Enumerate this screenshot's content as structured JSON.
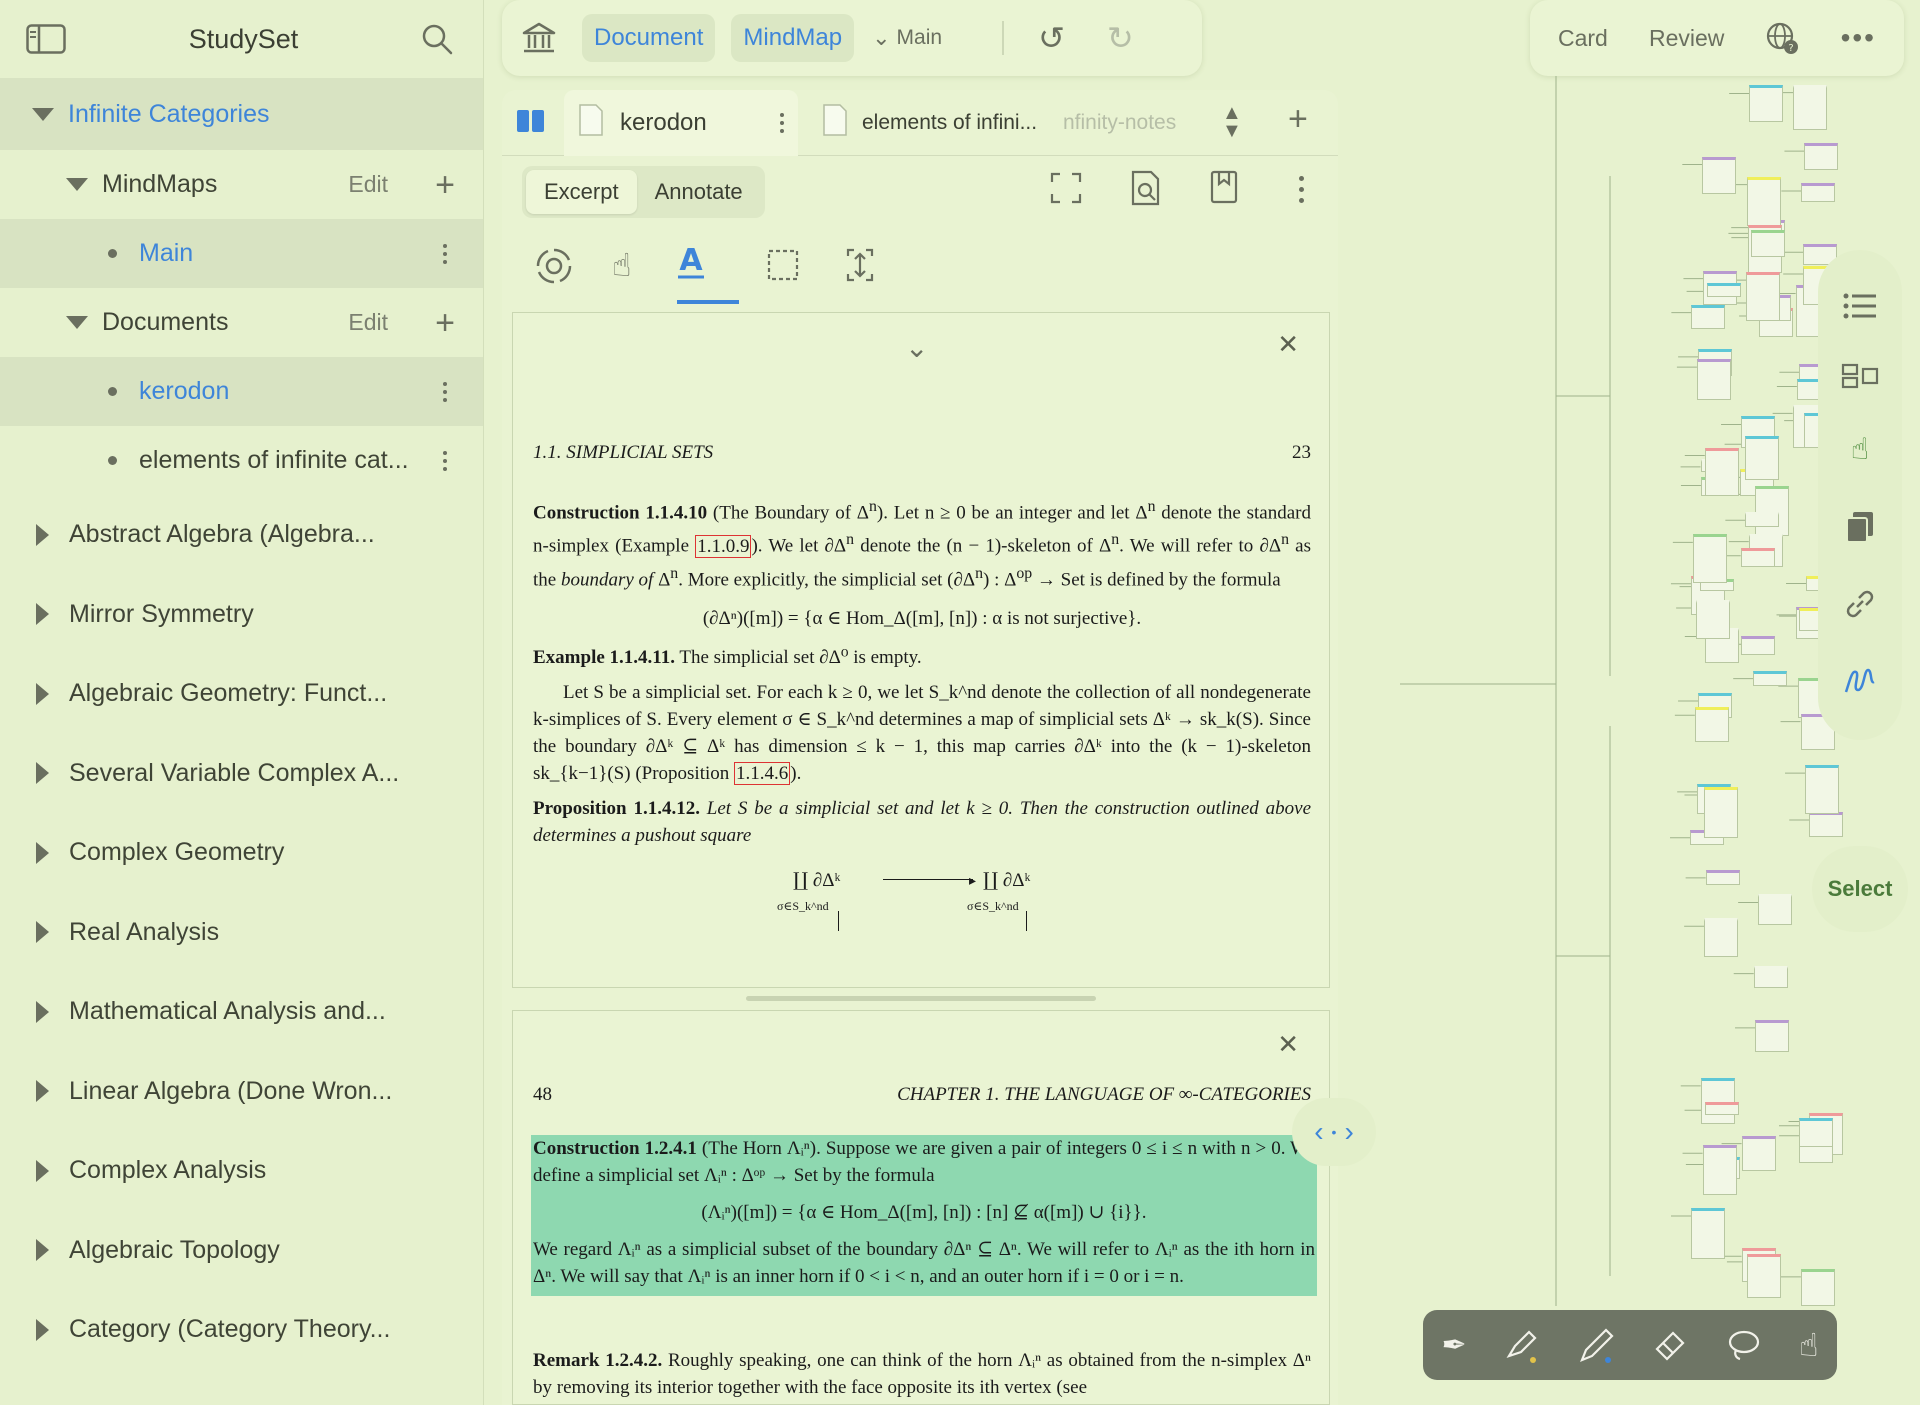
{
  "sidebar": {
    "title": "StudySet",
    "root": "Infinite Categories",
    "mindmaps": {
      "label": "MindMaps",
      "edit": "Edit",
      "items": [
        "Main"
      ]
    },
    "documents": {
      "label": "Documents",
      "edit": "Edit",
      "items": [
        "kerodon",
        "elements of infinite cat..."
      ]
    },
    "collapsed": [
      "Abstract Algebra (Algebra...",
      "Mirror Symmetry",
      "Algebraic Geometry: Funct...",
      "Several Variable Complex A...",
      "Complex Geometry",
      "Real Analysis",
      "Mathematical Analysis and...",
      "Linear Algebra (Done Wron...",
      "Complex Analysis",
      "Algebraic Topology",
      "Category (Category Theory..."
    ]
  },
  "top_toolbar": {
    "document": "Document",
    "mindmap": "MindMap",
    "main": "Main"
  },
  "right_toolbar": {
    "card": "Card",
    "review": "Review"
  },
  "doc_tabs": {
    "tab1": "kerodon",
    "tab2": "elements of infini...",
    "tab3": "nfinity-notes"
  },
  "segment": {
    "excerpt": "Excerpt",
    "annotate": "Annotate"
  },
  "page1": {
    "header_left": "1.1.   SIMPLICIAL SETS",
    "header_right": "23",
    "c1_title": "Construction 1.1.4.10",
    "c1_a": " (The Boundary of Δ",
    "c1_b": "). Let n ≥ 0 be an integer and let Δ",
    "c1_c": " denote the standard n-simplex (Example ",
    "c1_ref": "1.1.0.9",
    "c1_d": "). We let ∂Δ",
    "c1_e": " denote the (n − 1)-skeleton of Δ",
    "c1_f": ". We will refer to ∂Δ",
    "c1_g": " as the ",
    "c1_h": "boundary of",
    "c1_i": " Δ",
    "c1_j": ". More explicitly, the simplicial set (∂Δ",
    "c1_k": ") : Δ",
    "c1_l": " → Set is defined by the formula",
    "c1_formula": "(∂Δⁿ)([m]) = {α ∈ Hom_Δ([m], [n]) : α is not surjective}.",
    "e_title": "Example 1.1.4.11.",
    "e_body": " The simplicial set ∂Δ⁰ is empty.",
    "p_body": "Let S be a simplicial set. For each k ≥ 0, we let S_k^nd denote the collection of all nondegenerate k-simplices of S. Every element σ ∈ S_k^nd determines a map of simplicial sets Δᵏ → sk_k(S). Since the boundary ∂Δᵏ ⊆ Δᵏ has dimension ≤ k − 1, this map carries ∂Δᵏ into the (k − 1)-skeleton sk_{k−1}(S) (Proposition ",
    "p_ref": "1.1.4.6",
    "p_end": ").",
    "prop_title": "Proposition 1.1.4.12.",
    "prop_body": " Let S be a simplicial set and let k ≥ 0. Then the construction outlined above determines a pushout square",
    "diagram_left": "∐ ∂Δᵏ",
    "diagram_right": "∐ ∂Δᵏ",
    "diagram_sub": "σ∈S_k^nd"
  },
  "page2": {
    "header_left": "48",
    "header_right": "CHAPTER 1.   THE LANGUAGE OF ∞-CATEGORIES",
    "c_title": "Construction 1.2.4.1",
    "c_body": " (The Horn Λᵢⁿ). Suppose we are given a pair of integers 0 ≤ i ≤ n with n > 0. We define a simplicial set Λᵢⁿ : Δᵒᵖ → Set by the formula",
    "c_formula": "(Λᵢⁿ)([m]) = {α ∈ Hom_Δ([m], [n]) : [n] ⊈ α([m]) ∪ {i}}.",
    "c_body2": "We regard Λᵢⁿ as a simplicial subset of the boundary ∂Δⁿ ⊆ Δⁿ. We will refer to Λᵢⁿ as the ith horn in Δⁿ. We will say that Λᵢⁿ is an inner horn if 0 < i < n, and an outer horn if i = 0 or i = n.",
    "r_title": "Remark 1.2.4.2.",
    "r_body": " Roughly speaking, one can think of the horn Λᵢⁿ as obtained from the n-simplex Δⁿ by removing its interior together with the face opposite its ith vertex (see"
  },
  "right_panel": {
    "select": "Select"
  },
  "colors": {
    "accent": "#3e85d9",
    "background": "#e7f2cf",
    "highlight": "#8ed8b0"
  }
}
